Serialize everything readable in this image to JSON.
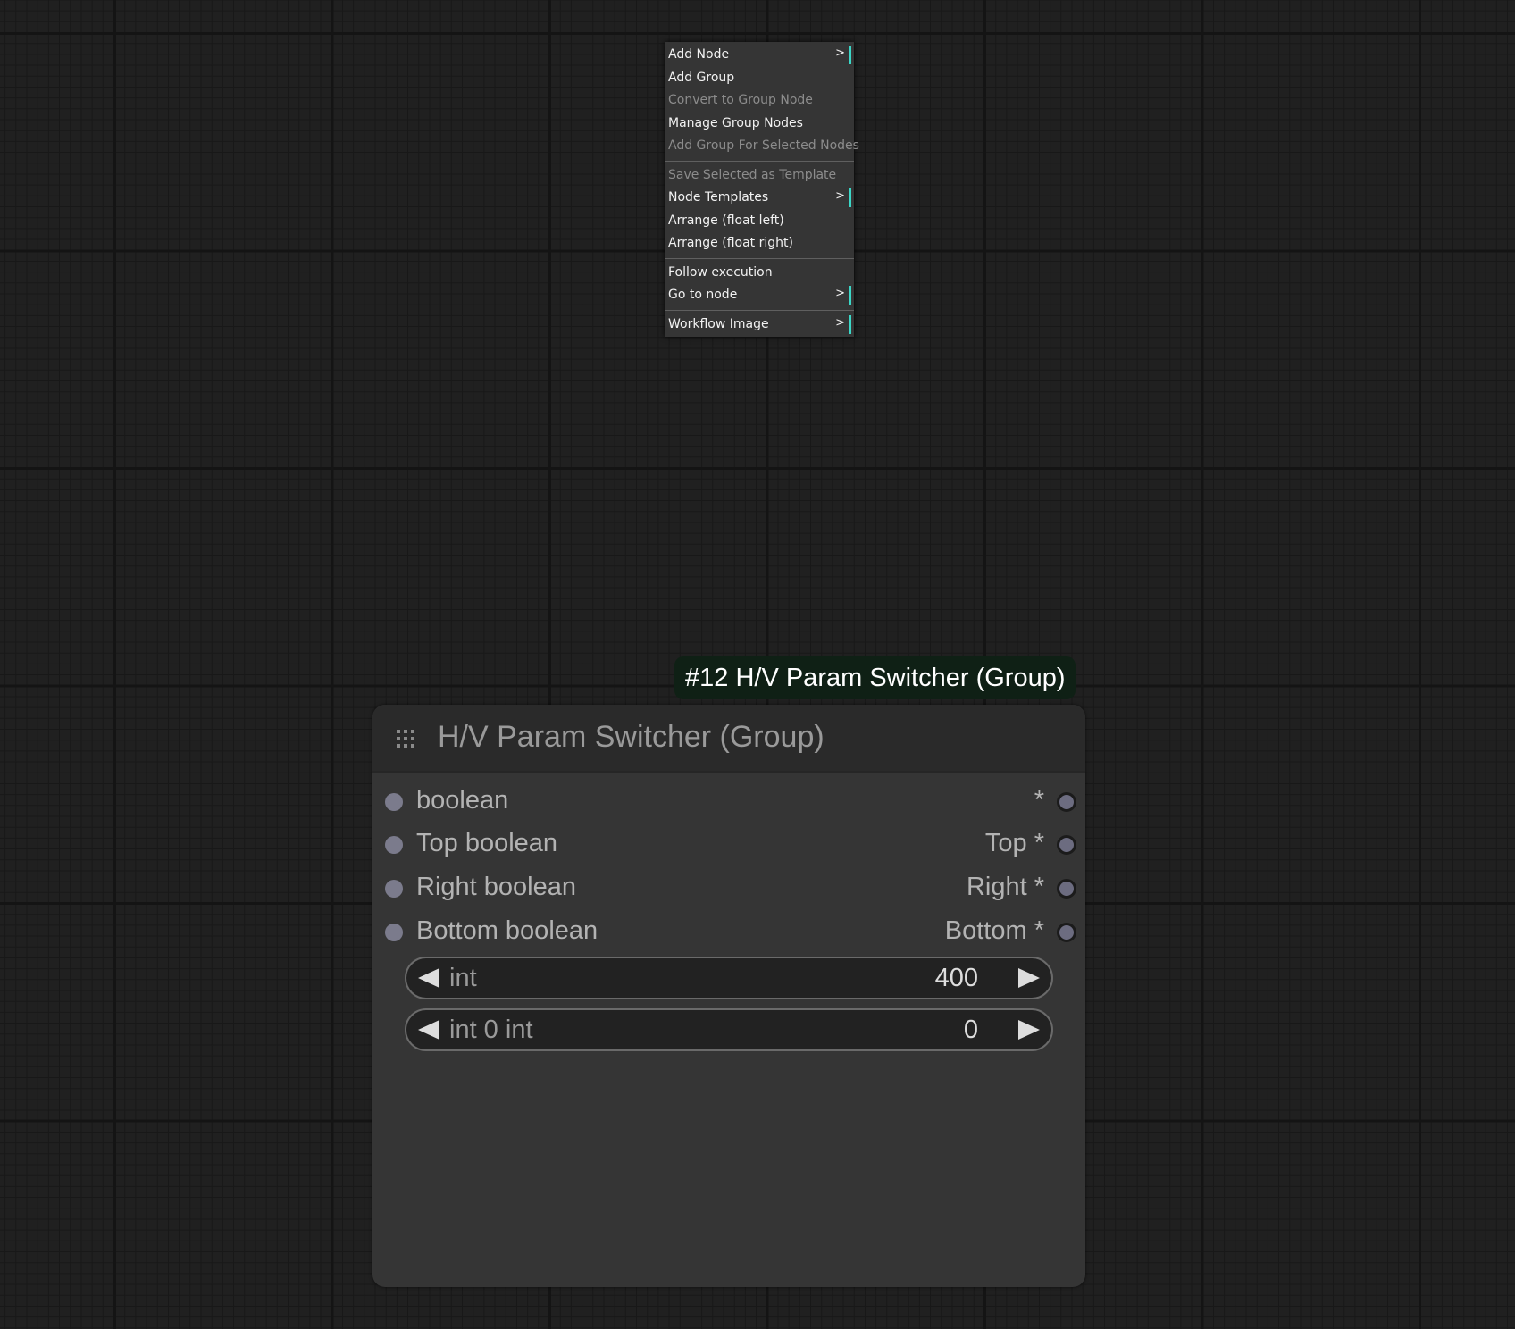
{
  "context_menu": {
    "items": [
      {
        "label": "Add Node",
        "submenu": true,
        "disabled": false
      },
      {
        "label": "Add Group",
        "submenu": false,
        "disabled": false
      },
      {
        "label": "Convert to Group Node",
        "submenu": false,
        "disabled": true
      },
      {
        "label": "Manage Group Nodes",
        "submenu": false,
        "disabled": false
      },
      {
        "label": "Add Group For Selected Nodes",
        "submenu": false,
        "disabled": true
      },
      {
        "label": "Save Selected as Template",
        "submenu": false,
        "disabled": true
      },
      {
        "label": "Node Templates",
        "submenu": true,
        "disabled": false
      },
      {
        "label": "Arrange (float left)",
        "submenu": false,
        "disabled": false
      },
      {
        "label": "Arrange (float right)",
        "submenu": false,
        "disabled": false
      },
      {
        "label": "Follow execution",
        "submenu": false,
        "disabled": false
      },
      {
        "label": "Go to node",
        "submenu": true,
        "disabled": false
      },
      {
        "label": "Workflow Image",
        "submenu": true,
        "disabled": false
      }
    ],
    "submenu_arrow": ">"
  },
  "node": {
    "badge": "#12 H/V Param Switcher (Group)",
    "title": "H/V Param Switcher (Group)",
    "grip_icon": "grip-dots-icon",
    "slots": [
      {
        "input": "boolean",
        "output": "*"
      },
      {
        "input": "Top boolean",
        "output": "Top *"
      },
      {
        "input": "Right boolean",
        "output": "Right *"
      },
      {
        "input": "Bottom boolean",
        "output": "Bottom *"
      }
    ],
    "widgets": [
      {
        "label": "int",
        "value": "400"
      },
      {
        "label": "int 0 int",
        "value": "0"
      }
    ]
  },
  "colors": {
    "menu_bg": "#353535",
    "submenu_accent": "#3bd8c8",
    "node_bg": "#353535",
    "badge_bg": "#0f2015",
    "input_slot": "#7b7b8c"
  }
}
